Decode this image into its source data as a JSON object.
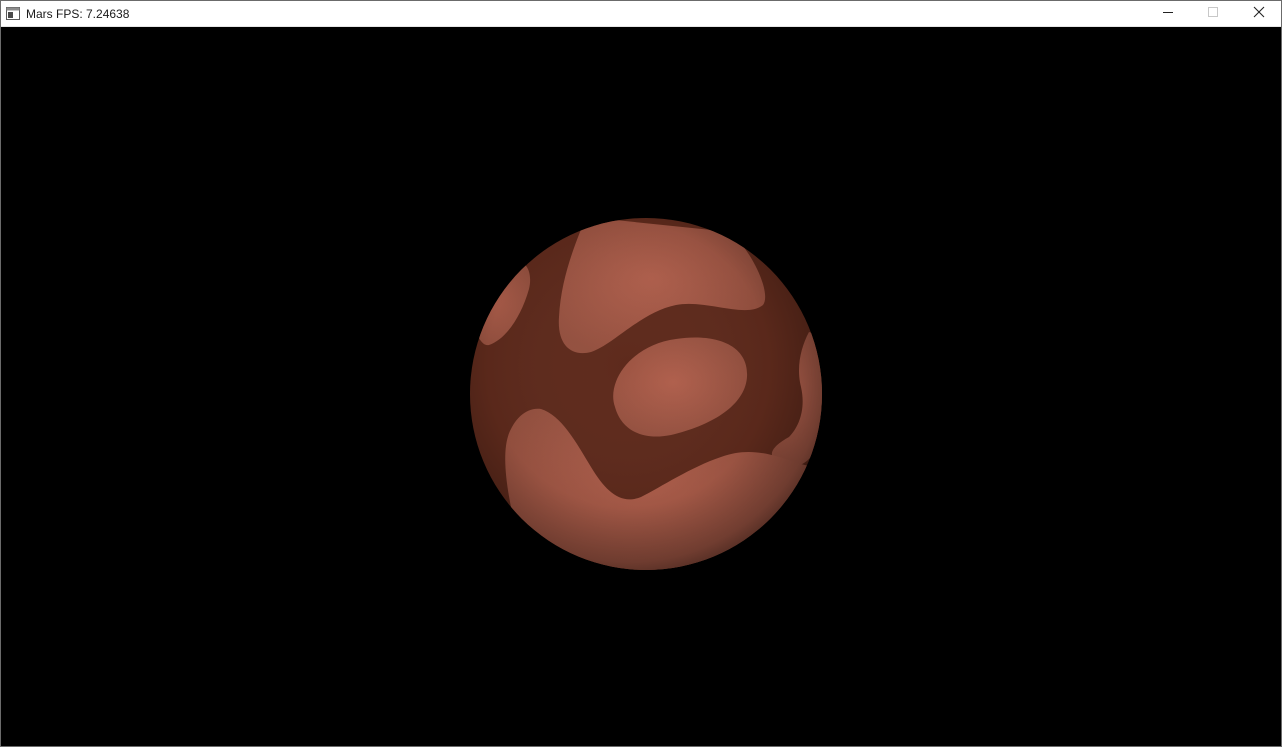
{
  "window": {
    "title": "Mars FPS: 7.24638",
    "icon": "app-window-icon",
    "controls": {
      "minimize_icon": "minimize-icon",
      "maximize_icon": "maximize-icon",
      "close_icon": "close-icon"
    }
  },
  "scene": {
    "background_color": "#000000",
    "planet": {
      "name_icon": "mars-planet",
      "light_color": "#a85a48",
      "dark_color": "#5e2a1c"
    }
  }
}
